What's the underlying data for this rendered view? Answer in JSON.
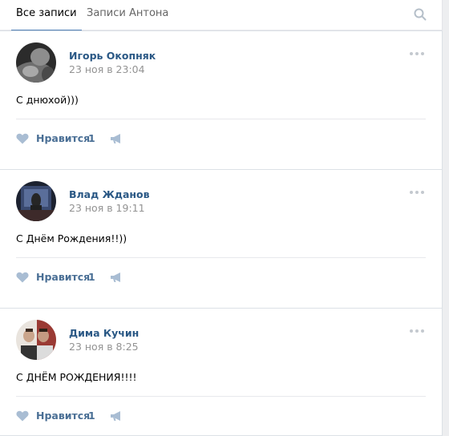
{
  "tabs": {
    "all": "Все записи",
    "owner": "Записи Антона"
  },
  "icons": {
    "search": "search-icon",
    "more": "more-icon",
    "like": "heart-icon",
    "share": "megaphone-icon"
  },
  "colors": {
    "link": "#2a5885",
    "accent": "#5181b8",
    "muted": "#939393",
    "background": "#edeef0"
  },
  "posts": [
    {
      "author": "Игорь Окопняк",
      "date": "23 ноя в 23:04",
      "text": "С днюхой)))",
      "like_label": "Нравится",
      "like_count": "1"
    },
    {
      "author": "Влад Жданов",
      "date": "23 ноя в 19:11",
      "text": "С Днём Рождения!!))",
      "like_label": "Нравится",
      "like_count": "1"
    },
    {
      "author": "Дима Кучин",
      "date": "23 ноя в 8:25",
      "text": "С ДНЁМ РОЖДЕНИЯ!!!!",
      "like_label": "Нравится",
      "like_count": "1"
    }
  ]
}
